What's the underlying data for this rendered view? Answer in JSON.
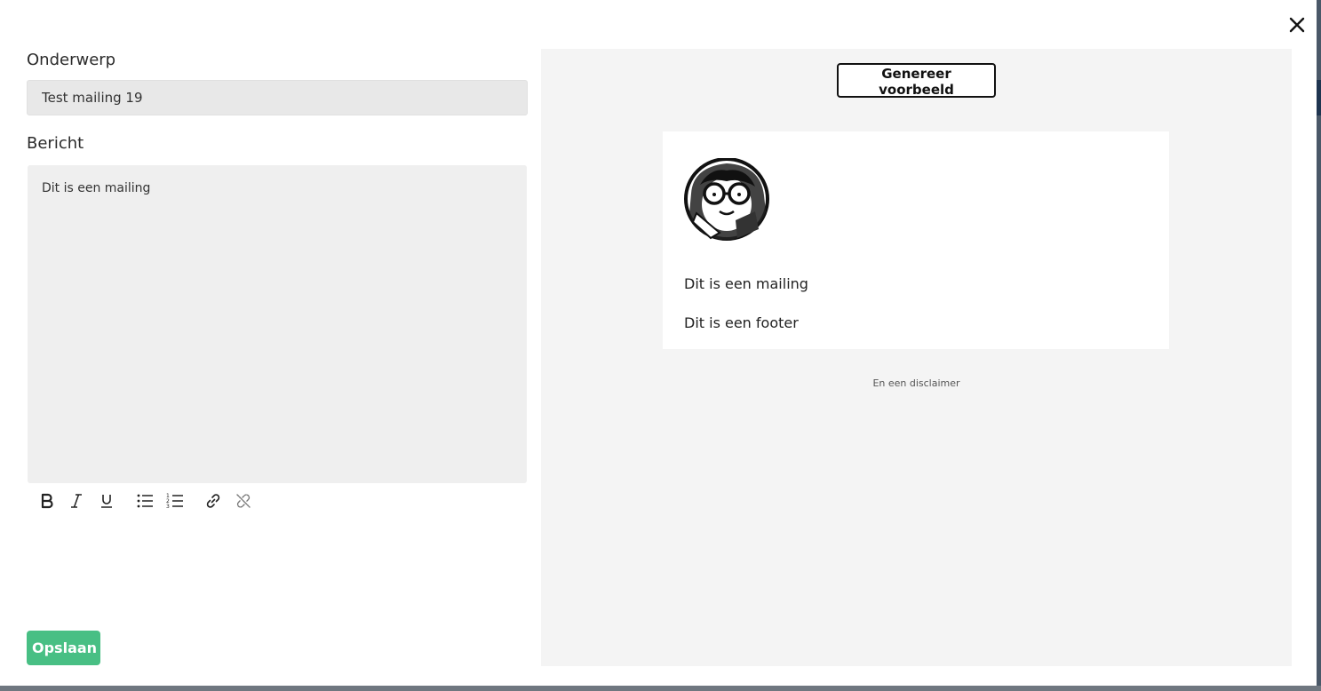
{
  "form": {
    "subject_label": "Onderwerp",
    "subject_value": "Test mailing 19",
    "message_label": "Bericht",
    "message_text": "Dit is een mailing",
    "save_label": "Opslaan"
  },
  "toolbar": {
    "icons": [
      "bold-icon",
      "italic-icon",
      "underline-icon",
      "bullet-list-icon",
      "numbered-list-icon",
      "link-icon",
      "unlink-icon"
    ]
  },
  "preview": {
    "generate_label": "Genereer voorbeeld",
    "mail_body": "Dit is een mailing",
    "mail_footer": "Dit is een footer",
    "disclaimer": "En een disclaimer"
  },
  "colors": {
    "save_button": "#48bf84",
    "preview_background": "#f4f4f4",
    "editor_background": "#efefef"
  }
}
